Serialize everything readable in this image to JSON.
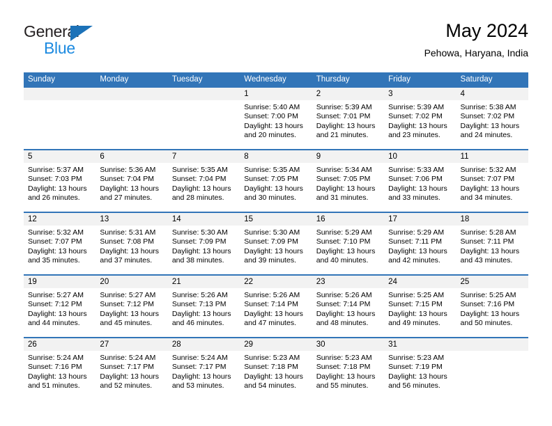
{
  "brand": {
    "name_part1": "General",
    "name_part2": "Blue",
    "triangle_color": "#1c72b8",
    "blue_text_color": "#1c8ae0",
    "dark_text_color": "#231f20"
  },
  "header": {
    "title": "May 2024",
    "subtitle": "Pehowa, Haryana, India",
    "header_bg_color": "#3275b8",
    "header_text_color": "#ffffff",
    "daterow_bg_color": "#f2f2f2"
  },
  "weekday_headers": [
    "Sunday",
    "Monday",
    "Tuesday",
    "Wednesday",
    "Thursday",
    "Friday",
    "Saturday"
  ],
  "weeks": [
    [
      {
        "day": "",
        "sunrise": "",
        "sunset": "",
        "daylight_line1": "",
        "daylight_line2": "",
        "empty": true
      },
      {
        "day": "",
        "sunrise": "",
        "sunset": "",
        "daylight_line1": "",
        "daylight_line2": "",
        "empty": true
      },
      {
        "day": "",
        "sunrise": "",
        "sunset": "",
        "daylight_line1": "",
        "daylight_line2": "",
        "empty": true
      },
      {
        "day": "1",
        "sunrise": "Sunrise: 5:40 AM",
        "sunset": "Sunset: 7:00 PM",
        "daylight_line1": "Daylight: 13 hours",
        "daylight_line2": "and 20 minutes.",
        "empty": false
      },
      {
        "day": "2",
        "sunrise": "Sunrise: 5:39 AM",
        "sunset": "Sunset: 7:01 PM",
        "daylight_line1": "Daylight: 13 hours",
        "daylight_line2": "and 21 minutes.",
        "empty": false
      },
      {
        "day": "3",
        "sunrise": "Sunrise: 5:39 AM",
        "sunset": "Sunset: 7:02 PM",
        "daylight_line1": "Daylight: 13 hours",
        "daylight_line2": "and 23 minutes.",
        "empty": false
      },
      {
        "day": "4",
        "sunrise": "Sunrise: 5:38 AM",
        "sunset": "Sunset: 7:02 PM",
        "daylight_line1": "Daylight: 13 hours",
        "daylight_line2": "and 24 minutes.",
        "empty": false
      }
    ],
    [
      {
        "day": "5",
        "sunrise": "Sunrise: 5:37 AM",
        "sunset": "Sunset: 7:03 PM",
        "daylight_line1": "Daylight: 13 hours",
        "daylight_line2": "and 26 minutes.",
        "empty": false
      },
      {
        "day": "6",
        "sunrise": "Sunrise: 5:36 AM",
        "sunset": "Sunset: 7:04 PM",
        "daylight_line1": "Daylight: 13 hours",
        "daylight_line2": "and 27 minutes.",
        "empty": false
      },
      {
        "day": "7",
        "sunrise": "Sunrise: 5:35 AM",
        "sunset": "Sunset: 7:04 PM",
        "daylight_line1": "Daylight: 13 hours",
        "daylight_line2": "and 28 minutes.",
        "empty": false
      },
      {
        "day": "8",
        "sunrise": "Sunrise: 5:35 AM",
        "sunset": "Sunset: 7:05 PM",
        "daylight_line1": "Daylight: 13 hours",
        "daylight_line2": "and 30 minutes.",
        "empty": false
      },
      {
        "day": "9",
        "sunrise": "Sunrise: 5:34 AM",
        "sunset": "Sunset: 7:05 PM",
        "daylight_line1": "Daylight: 13 hours",
        "daylight_line2": "and 31 minutes.",
        "empty": false
      },
      {
        "day": "10",
        "sunrise": "Sunrise: 5:33 AM",
        "sunset": "Sunset: 7:06 PM",
        "daylight_line1": "Daylight: 13 hours",
        "daylight_line2": "and 33 minutes.",
        "empty": false
      },
      {
        "day": "11",
        "sunrise": "Sunrise: 5:32 AM",
        "sunset": "Sunset: 7:07 PM",
        "daylight_line1": "Daylight: 13 hours",
        "daylight_line2": "and 34 minutes.",
        "empty": false
      }
    ],
    [
      {
        "day": "12",
        "sunrise": "Sunrise: 5:32 AM",
        "sunset": "Sunset: 7:07 PM",
        "daylight_line1": "Daylight: 13 hours",
        "daylight_line2": "and 35 minutes.",
        "empty": false
      },
      {
        "day": "13",
        "sunrise": "Sunrise: 5:31 AM",
        "sunset": "Sunset: 7:08 PM",
        "daylight_line1": "Daylight: 13 hours",
        "daylight_line2": "and 37 minutes.",
        "empty": false
      },
      {
        "day": "14",
        "sunrise": "Sunrise: 5:30 AM",
        "sunset": "Sunset: 7:09 PM",
        "daylight_line1": "Daylight: 13 hours",
        "daylight_line2": "and 38 minutes.",
        "empty": false
      },
      {
        "day": "15",
        "sunrise": "Sunrise: 5:30 AM",
        "sunset": "Sunset: 7:09 PM",
        "daylight_line1": "Daylight: 13 hours",
        "daylight_line2": "and 39 minutes.",
        "empty": false
      },
      {
        "day": "16",
        "sunrise": "Sunrise: 5:29 AM",
        "sunset": "Sunset: 7:10 PM",
        "daylight_line1": "Daylight: 13 hours",
        "daylight_line2": "and 40 minutes.",
        "empty": false
      },
      {
        "day": "17",
        "sunrise": "Sunrise: 5:29 AM",
        "sunset": "Sunset: 7:11 PM",
        "daylight_line1": "Daylight: 13 hours",
        "daylight_line2": "and 42 minutes.",
        "empty": false
      },
      {
        "day": "18",
        "sunrise": "Sunrise: 5:28 AM",
        "sunset": "Sunset: 7:11 PM",
        "daylight_line1": "Daylight: 13 hours",
        "daylight_line2": "and 43 minutes.",
        "empty": false
      }
    ],
    [
      {
        "day": "19",
        "sunrise": "Sunrise: 5:27 AM",
        "sunset": "Sunset: 7:12 PM",
        "daylight_line1": "Daylight: 13 hours",
        "daylight_line2": "and 44 minutes.",
        "empty": false
      },
      {
        "day": "20",
        "sunrise": "Sunrise: 5:27 AM",
        "sunset": "Sunset: 7:12 PM",
        "daylight_line1": "Daylight: 13 hours",
        "daylight_line2": "and 45 minutes.",
        "empty": false
      },
      {
        "day": "21",
        "sunrise": "Sunrise: 5:26 AM",
        "sunset": "Sunset: 7:13 PM",
        "daylight_line1": "Daylight: 13 hours",
        "daylight_line2": "and 46 minutes.",
        "empty": false
      },
      {
        "day": "22",
        "sunrise": "Sunrise: 5:26 AM",
        "sunset": "Sunset: 7:14 PM",
        "daylight_line1": "Daylight: 13 hours",
        "daylight_line2": "and 47 minutes.",
        "empty": false
      },
      {
        "day": "23",
        "sunrise": "Sunrise: 5:26 AM",
        "sunset": "Sunset: 7:14 PM",
        "daylight_line1": "Daylight: 13 hours",
        "daylight_line2": "and 48 minutes.",
        "empty": false
      },
      {
        "day": "24",
        "sunrise": "Sunrise: 5:25 AM",
        "sunset": "Sunset: 7:15 PM",
        "daylight_line1": "Daylight: 13 hours",
        "daylight_line2": "and 49 minutes.",
        "empty": false
      },
      {
        "day": "25",
        "sunrise": "Sunrise: 5:25 AM",
        "sunset": "Sunset: 7:16 PM",
        "daylight_line1": "Daylight: 13 hours",
        "daylight_line2": "and 50 minutes.",
        "empty": false
      }
    ],
    [
      {
        "day": "26",
        "sunrise": "Sunrise: 5:24 AM",
        "sunset": "Sunset: 7:16 PM",
        "daylight_line1": "Daylight: 13 hours",
        "daylight_line2": "and 51 minutes.",
        "empty": false
      },
      {
        "day": "27",
        "sunrise": "Sunrise: 5:24 AM",
        "sunset": "Sunset: 7:17 PM",
        "daylight_line1": "Daylight: 13 hours",
        "daylight_line2": "and 52 minutes.",
        "empty": false
      },
      {
        "day": "28",
        "sunrise": "Sunrise: 5:24 AM",
        "sunset": "Sunset: 7:17 PM",
        "daylight_line1": "Daylight: 13 hours",
        "daylight_line2": "and 53 minutes.",
        "empty": false
      },
      {
        "day": "29",
        "sunrise": "Sunrise: 5:23 AM",
        "sunset": "Sunset: 7:18 PM",
        "daylight_line1": "Daylight: 13 hours",
        "daylight_line2": "and 54 minutes.",
        "empty": false
      },
      {
        "day": "30",
        "sunrise": "Sunrise: 5:23 AM",
        "sunset": "Sunset: 7:18 PM",
        "daylight_line1": "Daylight: 13 hours",
        "daylight_line2": "and 55 minutes.",
        "empty": false
      },
      {
        "day": "31",
        "sunrise": "Sunrise: 5:23 AM",
        "sunset": "Sunset: 7:19 PM",
        "daylight_line1": "Daylight: 13 hours",
        "daylight_line2": "and 56 minutes.",
        "empty": false
      },
      {
        "day": "",
        "sunrise": "",
        "sunset": "",
        "daylight_line1": "",
        "daylight_line2": "",
        "empty": true
      }
    ]
  ]
}
